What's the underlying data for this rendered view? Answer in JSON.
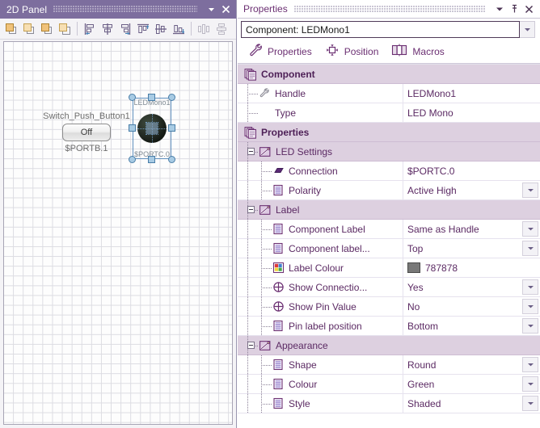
{
  "left_panel": {
    "title": "2D Panel",
    "title_buttons": [
      {
        "name": "panel-menu-button",
        "glyph": "▼"
      },
      {
        "name": "panel-close-button",
        "glyph": "✕"
      }
    ],
    "toolbar": [
      {
        "name": "bring-to-front-button",
        "tip": "Bring to Front",
        "enabled": true
      },
      {
        "name": "bring-forward-button",
        "tip": "Bring Forward",
        "enabled": true
      },
      {
        "name": "send-backward-button",
        "tip": "Send Backward",
        "enabled": true
      },
      {
        "name": "send-to-back-button",
        "tip": "Send to Back",
        "enabled": true
      },
      {
        "name": "align-left-button",
        "tip": "Align Left",
        "enabled": true
      },
      {
        "name": "align-center-button",
        "tip": "Align Center",
        "enabled": true
      },
      {
        "name": "align-right-button",
        "tip": "Align Right",
        "enabled": true
      },
      {
        "name": "align-top-button",
        "tip": "Align Top",
        "enabled": true
      },
      {
        "name": "align-middle-button",
        "tip": "Align Middle",
        "enabled": true
      },
      {
        "name": "align-bottom-button",
        "tip": "Align Bottom",
        "enabled": true
      },
      {
        "name": "distribute-horizontally-button",
        "tip": "Distribute Horizontally",
        "enabled": false
      },
      {
        "name": "distribute-vertically-button",
        "tip": "Distribute Vertically",
        "enabled": false
      }
    ],
    "canvas": {
      "push_button": {
        "label": "Switch_Push_Button1",
        "state_text": "Off",
        "pin": "$PORTB.1"
      },
      "led": {
        "label": "LEDMono1",
        "pin": "$PORTC.0",
        "selected": true
      }
    }
  },
  "right_panel": {
    "title": "Properties",
    "title_buttons": [
      {
        "name": "properties-menu-button",
        "glyph": "▼"
      },
      {
        "name": "properties-pin-button",
        "glyph": "pin"
      },
      {
        "name": "properties-close-button",
        "glyph": "✕"
      }
    ],
    "selector": {
      "value": "Component: LEDMono1"
    },
    "tabs": [
      {
        "label": "Properties",
        "icon": "wrench-icon",
        "active": true
      },
      {
        "label": "Position",
        "icon": "move-icon",
        "active": false
      },
      {
        "label": "Macros",
        "icon": "macros-icon",
        "active": false
      }
    ],
    "rows": [
      {
        "type": "group",
        "name": "Component",
        "value": "",
        "icon": "pages-icon",
        "level": 0,
        "dropdown": false
      },
      {
        "type": "item",
        "name": "Handle",
        "value": "LEDMono1",
        "icon": "wrench-icon",
        "level": 1,
        "dropdown": false
      },
      {
        "type": "item",
        "name": "Type",
        "value": "LED Mono",
        "icon": "none",
        "level": 1,
        "dropdown": false
      },
      {
        "type": "group",
        "name": "Properties",
        "value": "",
        "icon": "pages-icon",
        "level": 0,
        "dropdown": false
      },
      {
        "type": "sub",
        "name": "LED Settings",
        "value": "",
        "icon": "folder-icon",
        "level": 1,
        "dropdown": false
      },
      {
        "type": "item",
        "name": "Connection",
        "value": "$PORTC.0",
        "icon": "connection-icon",
        "level": 2,
        "dropdown": false
      },
      {
        "type": "item",
        "name": "Polarity",
        "value": "Active High",
        "icon": "list-icon",
        "level": 2,
        "dropdown": true
      },
      {
        "type": "sub",
        "name": "Label",
        "value": "",
        "icon": "folder-icon",
        "level": 1,
        "dropdown": false
      },
      {
        "type": "item",
        "name": "Component Label",
        "value": "Same as Handle",
        "icon": "list-icon",
        "level": 2,
        "dropdown": true
      },
      {
        "type": "item",
        "name": "Component label...",
        "value": "Top",
        "icon": "list-icon",
        "level": 2,
        "dropdown": true
      },
      {
        "type": "colour",
        "name": "Label Colour",
        "value": "787878",
        "icon": "palette-icon",
        "level": 2,
        "dropdown": false,
        "swatch": "#787878"
      },
      {
        "type": "item",
        "name": "Show Connectio...",
        "value": "Yes",
        "icon": "pin-circle-icon",
        "level": 2,
        "dropdown": true
      },
      {
        "type": "item",
        "name": "Show Pin Value",
        "value": "No",
        "icon": "pin-circle-icon",
        "level": 2,
        "dropdown": true
      },
      {
        "type": "item",
        "name": "Pin label position",
        "value": "Bottom",
        "icon": "list-icon",
        "level": 2,
        "dropdown": true
      },
      {
        "type": "sub",
        "name": "Appearance",
        "value": "",
        "icon": "folder-icon",
        "level": 1,
        "dropdown": false
      },
      {
        "type": "item",
        "name": "Shape",
        "value": "Round",
        "icon": "list-icon",
        "level": 2,
        "dropdown": true
      },
      {
        "type": "item",
        "name": "Colour",
        "value": "Green",
        "icon": "list-icon",
        "level": 2,
        "dropdown": true
      },
      {
        "type": "item",
        "name": "Style",
        "value": "Shaded",
        "icon": "list-icon",
        "level": 2,
        "dropdown": true
      }
    ]
  },
  "colors": {
    "title_bar": "#7d6e9e",
    "group_row": "#ddd0e0",
    "text_purple": "#5b2a63",
    "label_colour_value": "#787878",
    "selection_handle": "#a8cbe4"
  }
}
